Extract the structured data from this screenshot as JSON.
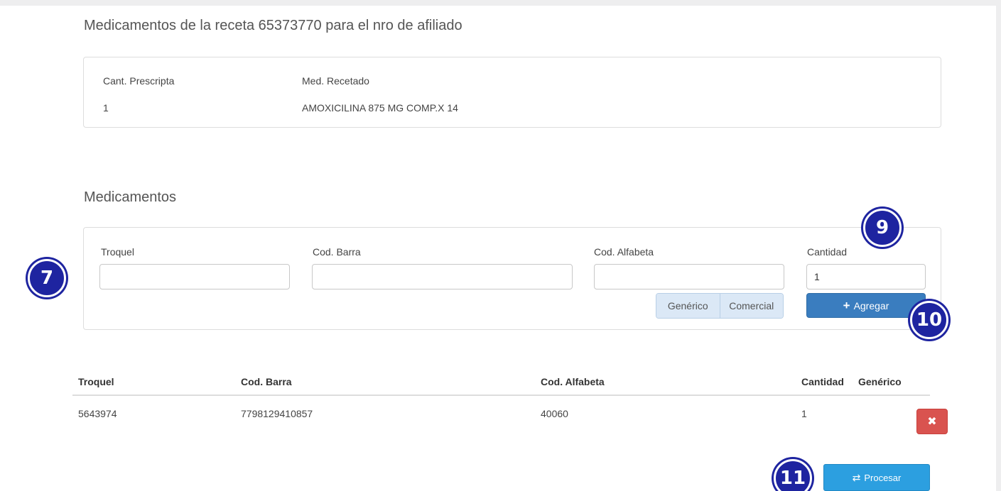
{
  "page_title": "Medicamentos de la receta 65373770 para el nro de afiliado",
  "recipe": {
    "quantity_label": "Cant. Prescripta",
    "quantity_value": "1",
    "drug_label": "Med. Recetado",
    "drug_value": "AMOXICILINA 875 MG COMP.X 14"
  },
  "section_title": "Medicamentos",
  "search": {
    "troquel_label": "Troquel",
    "troquel_value": "",
    "barcode_label": "Cod. Barra",
    "barcode_value": "",
    "alfabeta_label": "Cod. Alfabeta",
    "alfabeta_value": "",
    "cantidad_label": "Cantidad",
    "cantidad_value": "1",
    "generic_label": "Genérico",
    "commercial_label": "Comercial",
    "add_label": "Agregar",
    "add_icon": "plus-icon"
  },
  "table": {
    "headers": [
      "Troquel",
      "Cod. Barra",
      "Cod. Alfabeta",
      "Cantidad",
      "Genérico"
    ],
    "rows": [
      {
        "troquel": "5643974",
        "barcode": "7798129410857",
        "alfabeta": "40060",
        "cantidad": "1",
        "delete_icon": "close-icon"
      }
    ]
  },
  "process_label": "Procesar",
  "process_icon": "swap-icon",
  "annotations": [
    "7",
    "9",
    "10",
    "11"
  ],
  "colors": {
    "primary": "#3a7dbf",
    "info": "#2c9fe0",
    "danger": "#d9534f",
    "toggle": "#dbe8f6",
    "badge": "#1e24a0"
  }
}
